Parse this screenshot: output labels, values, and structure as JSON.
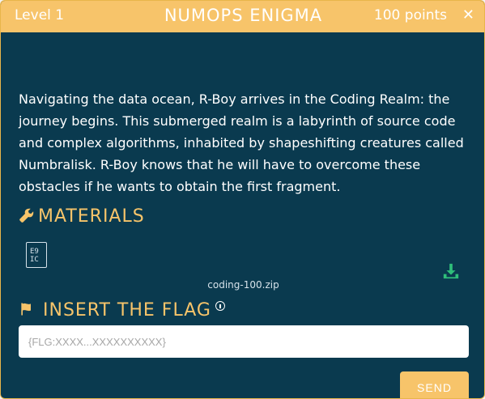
{
  "header": {
    "level": "Level 1",
    "title": "NUMOPS ENIGMA",
    "points": "100 points"
  },
  "description": "Navigating the data ocean, R-Boy arrives in the Coding Realm: the journey begins. This submerged realm is a labyrinth of source code and complex algorithms, inhabited by shapeshifting creatures called Numbralisk. R-Boy knows that he will have to overcome these obstacles if he wants to obtain the first fragment.",
  "materials": {
    "heading": "MATERIALS",
    "file_icon_text": [
      "E9",
      "IC"
    ],
    "filename": "coding-100.zip"
  },
  "flag": {
    "heading": "INSERT THE FLAG",
    "placeholder": "{FLG:XXXX...XXXXXXXXXX}",
    "value": ""
  },
  "send_label": "SEND",
  "icons": {
    "close": "close-icon",
    "wrench": "wrench-icon",
    "flag": "flag-icon",
    "download": "download-icon",
    "info": "info-icon"
  },
  "colors": {
    "background": "#0a3a4f",
    "accent": "#f7c46a",
    "download": "#2fbf7a"
  }
}
